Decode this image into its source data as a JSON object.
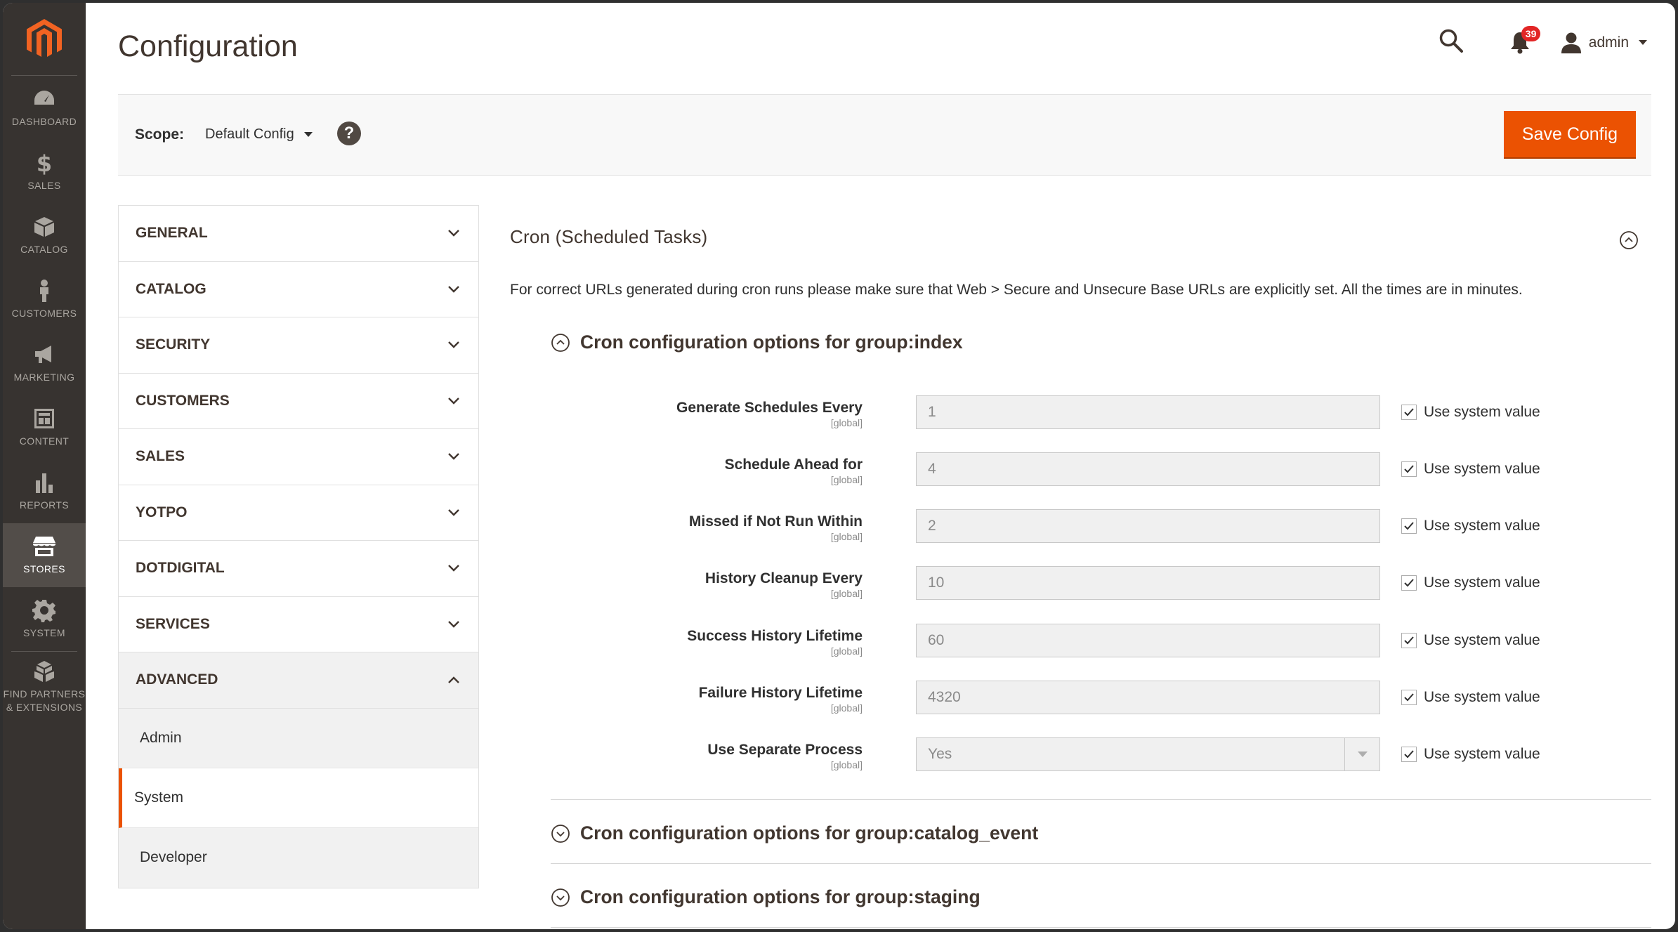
{
  "nav": {
    "items": [
      {
        "label": "DASHBOARD",
        "icon": "dashboard-icon"
      },
      {
        "label": "SALES",
        "icon": "dollar-icon"
      },
      {
        "label": "CATALOG",
        "icon": "box-icon"
      },
      {
        "label": "CUSTOMERS",
        "icon": "person-icon"
      },
      {
        "label": "MARKETING",
        "icon": "megaphone-icon"
      },
      {
        "label": "CONTENT",
        "icon": "content-icon"
      },
      {
        "label": "REPORTS",
        "icon": "bar-chart-icon"
      },
      {
        "label": "STORES",
        "icon": "store-icon",
        "active": true
      },
      {
        "label": "SYSTEM",
        "icon": "gear-icon"
      },
      {
        "label_line1": "FIND PARTNERS",
        "label_line2": "& EXTENSIONS",
        "icon": "cubes-icon"
      }
    ]
  },
  "header": {
    "title": "Configuration",
    "notification_count": "39",
    "user": "admin"
  },
  "scope": {
    "label": "Scope:",
    "value": "Default Config",
    "help": "?",
    "save_label": "Save Config"
  },
  "tabs": {
    "items": [
      "GENERAL",
      "CATALOG",
      "SECURITY",
      "CUSTOMERS",
      "SALES",
      "YOTPO",
      "DOTDIGITAL",
      "SERVICES",
      "ADVANCED"
    ],
    "subitems": [
      "Admin",
      "System",
      "Developer"
    ],
    "active_subitem": "System"
  },
  "section": {
    "title": "Cron (Scheduled Tasks)",
    "note": "For correct URLs generated during cron runs please make sure that Web > Secure and Unsecure Base URLs are explicitly set. All the times are in minutes.",
    "groups": [
      "Cron configuration options for group:index",
      "Cron configuration options for group:catalog_event",
      "Cron configuration options for group:staging"
    ],
    "scope_tag": "[global]",
    "system_value_label": "Use system value",
    "fields": [
      {
        "label": "Generate Schedules Every",
        "value": "1"
      },
      {
        "label": "Schedule Ahead for",
        "value": "4"
      },
      {
        "label": "Missed if Not Run Within",
        "value": "2"
      },
      {
        "label": "History Cleanup Every",
        "value": "10"
      },
      {
        "label": "Success History Lifetime",
        "value": "60"
      },
      {
        "label": "Failure History Lifetime",
        "value": "4320"
      },
      {
        "label": "Use Separate Process",
        "value": "Yes"
      }
    ]
  },
  "colors": {
    "accent": "#eb5202",
    "nav_bg": "#373330",
    "nav_active": "#524d49"
  }
}
